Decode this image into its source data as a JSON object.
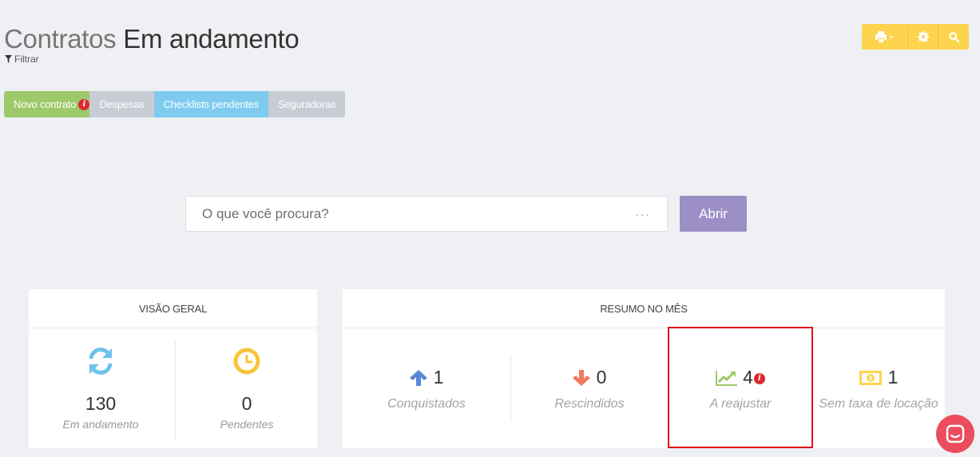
{
  "header": {
    "title_light": "Contratos",
    "title_dark": "Em andamento",
    "filter_label": "Filtrar"
  },
  "toolbar": {
    "print_icon": "print-icon",
    "settings_icon": "gear-icon",
    "search_icon": "search-icon",
    "color": "#fdd44d"
  },
  "tabs": [
    {
      "label": "Novo contrato",
      "color": "#9dc96a",
      "badge": "i"
    },
    {
      "label": "Despesas",
      "color": "#c8ccd4"
    },
    {
      "label": "Checklists pendentes",
      "color": "#7ecbef"
    },
    {
      "label": "Seguradoras",
      "color": "#c8ccd4"
    }
  ],
  "search": {
    "placeholder": "O que você procura?",
    "more": "···",
    "button_label": "Abrir",
    "button_color": "#9b8fc6"
  },
  "overview": {
    "title": "VISÃO GERAL",
    "items": [
      {
        "value": "130",
        "label": "Em andamento",
        "icon": "refresh-icon",
        "color": "#6cc3ec"
      },
      {
        "value": "0",
        "label": "Pendentes",
        "icon": "clock-icon",
        "color": "#f8c43c"
      }
    ]
  },
  "summary": {
    "title": "RESUMO NO MÊS",
    "items": [
      {
        "value": "1",
        "label": "Conquistados",
        "icon": "arrow-up-icon",
        "color": "#5a86d8"
      },
      {
        "value": "0",
        "label": "Rescindidos",
        "icon": "arrow-down-icon",
        "color": "#f07a5a"
      },
      {
        "value": "4",
        "label": "A reajustar",
        "icon": "trend-up-icon",
        "color": "#9dc96a",
        "badge": "i"
      },
      {
        "value": "1",
        "label": "Sem taxa de locação",
        "icon": "money-icon",
        "color": "#fdd44d"
      }
    ]
  },
  "chat": {
    "icon": "chat-icon",
    "color": "#eb4d5c"
  }
}
